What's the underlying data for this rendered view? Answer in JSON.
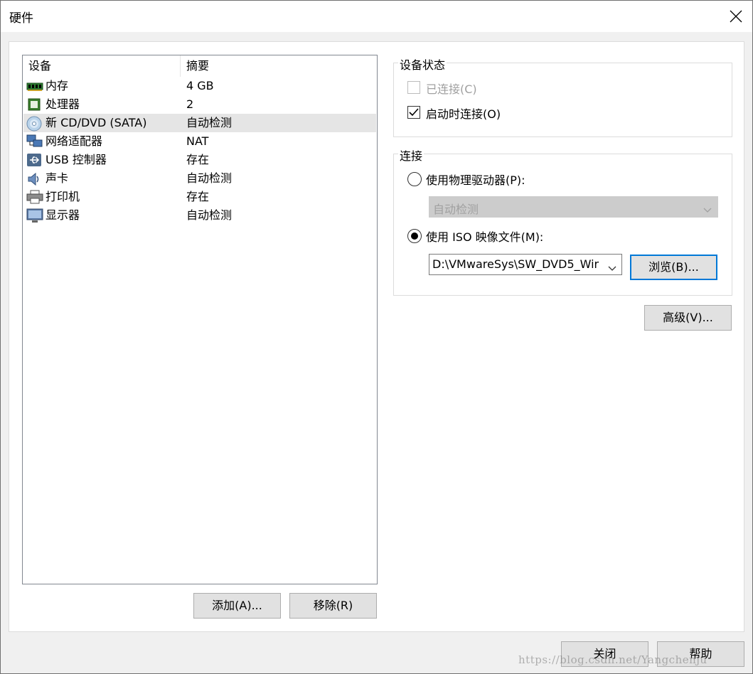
{
  "window": {
    "title": "硬件"
  },
  "device_list": {
    "columns": [
      "设备",
      "摘要"
    ],
    "rows": [
      {
        "icon": "memory-icon",
        "name": "内存",
        "summary": "4 GB"
      },
      {
        "icon": "processor-icon",
        "name": "处理器",
        "summary": "2"
      },
      {
        "icon": "cd-dvd-icon",
        "name": "新 CD/DVD (SATA)",
        "summary": "自动检测",
        "selected": true
      },
      {
        "icon": "network-adapter-icon",
        "name": "网络适配器",
        "summary": "NAT"
      },
      {
        "icon": "usb-icon",
        "name": "USB 控制器",
        "summary": "存在"
      },
      {
        "icon": "sound-card-icon",
        "name": "声卡",
        "summary": "自动检测"
      },
      {
        "icon": "printer-icon",
        "name": "打印机",
        "summary": "存在"
      },
      {
        "icon": "display-icon",
        "name": "显示器",
        "summary": "自动检测"
      }
    ]
  },
  "list_buttons": {
    "add": "添加(A)...",
    "remove": "移除(R)"
  },
  "device_status": {
    "title": "设备状态",
    "connected": {
      "label": "已连接(C)",
      "checked": false,
      "disabled": true
    },
    "connect_at_power_on": {
      "label": "启动时连接(O)",
      "checked": true
    }
  },
  "connection": {
    "title": "连接",
    "physical_drive": {
      "label": "使用物理驱动器(P):",
      "selected": false,
      "dropdown_value": "自动检测"
    },
    "iso_image": {
      "label": "使用 ISO 映像文件(M):",
      "selected": true,
      "path_value": "D:\\VMwareSys\\SW_DVD5_Wir"
    },
    "browse_label": "浏览(B)..."
  },
  "advanced_label": "高级(V)...",
  "footer": {
    "close": "关闭",
    "help": "帮助",
    "watermark": "https://blog.csdn.net/Yangchenju"
  }
}
